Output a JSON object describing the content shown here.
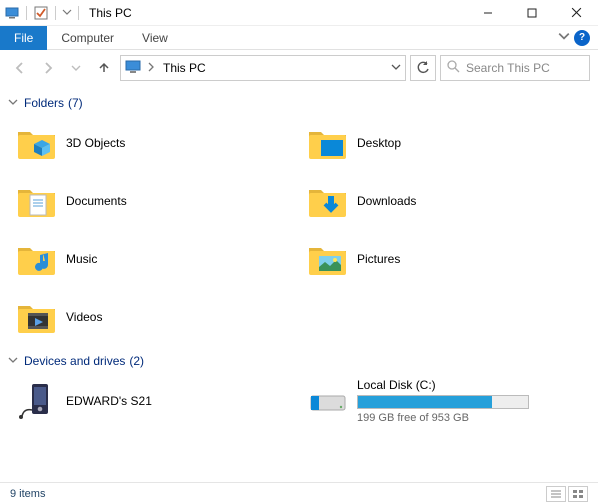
{
  "window": {
    "title": "This PC",
    "minimize": "Minimize",
    "maximize": "Maximize",
    "close": "Close"
  },
  "ribbon": {
    "file": "File",
    "computer": "Computer",
    "view": "View"
  },
  "nav": {
    "crumb": "This PC",
    "search_placeholder": "Search This PC"
  },
  "sections": {
    "folders": {
      "label": "Folders",
      "count": "(7)"
    },
    "drives": {
      "label": "Devices and drives",
      "count": "(2)"
    }
  },
  "folders": [
    {
      "label": "3D Objects"
    },
    {
      "label": "Desktop"
    },
    {
      "label": "Documents"
    },
    {
      "label": "Downloads"
    },
    {
      "label": "Music"
    },
    {
      "label": "Pictures"
    },
    {
      "label": "Videos"
    }
  ],
  "devices": {
    "phone": {
      "label": "EDWARD's S21"
    },
    "disk": {
      "label": "Local Disk (C:)",
      "sub": "199 GB free of 953 GB",
      "used_pct": 79
    }
  },
  "status": {
    "text": "9 items"
  }
}
